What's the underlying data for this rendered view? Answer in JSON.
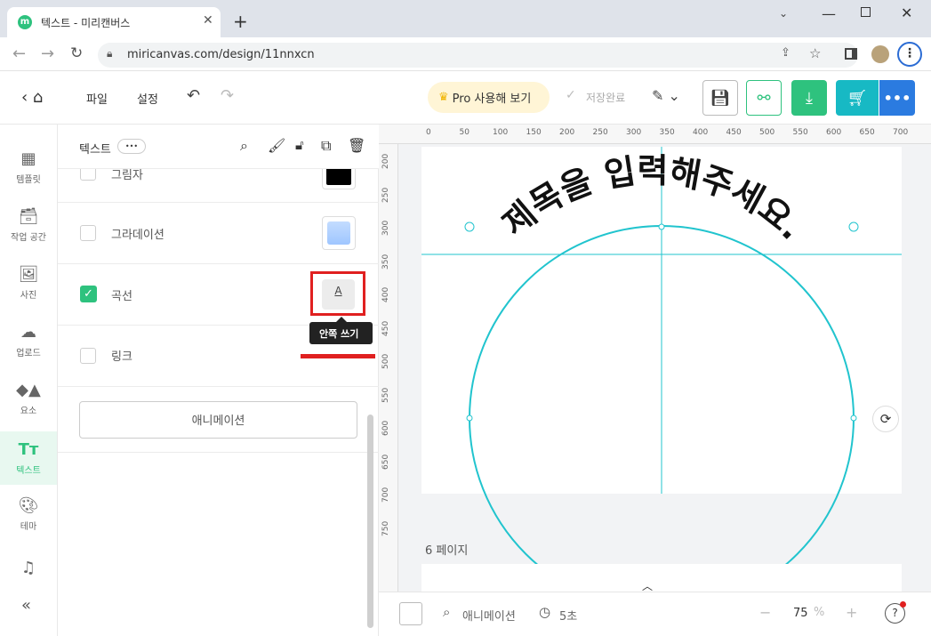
{
  "browser": {
    "tab_title": "텍스트 - 미리캔버스",
    "url": "miricanvas.com/design/11nnxcn"
  },
  "header": {
    "file": "파일",
    "settings": "설정",
    "pro": "Pro 사용해 보기",
    "saved": "저장완료"
  },
  "leftnav": {
    "items": [
      {
        "label": "템플릿",
        "icon": "template-icon"
      },
      {
        "label": "작업 공간",
        "icon": "archive-icon"
      },
      {
        "label": "사진",
        "icon": "image-icon"
      },
      {
        "label": "업로드",
        "icon": "upload-cloud-icon"
      },
      {
        "label": "요소",
        "icon": "shapes-icon"
      },
      {
        "label": "텍스트",
        "icon": "text-icon"
      },
      {
        "label": "테마",
        "icon": "palette-icon"
      }
    ]
  },
  "panel": {
    "title": "텍스트",
    "more": "•••",
    "rows": {
      "shadow": "그림자",
      "gradient": "그라데이션",
      "curve": "곡선",
      "link": "링크"
    },
    "animation_button": "애니메이션",
    "tooltip": "안쪽 쓰기"
  },
  "canvas": {
    "curved_text": "제목을 입력해주세요.",
    "ruler_top": [
      "0",
      "50",
      "100",
      "150",
      "200",
      "250",
      "300",
      "350",
      "400",
      "450",
      "500",
      "550",
      "600",
      "650",
      "700"
    ],
    "ruler_left": [
      "200",
      "250",
      "300",
      "350",
      "400",
      "450",
      "500",
      "550",
      "600",
      "650",
      "700",
      "750"
    ],
    "page_label": "6 페이지"
  },
  "bottombar": {
    "animation": "애니메이션",
    "duration": "5초",
    "zoom": "75",
    "zoom_unit": "%"
  },
  "colors": {
    "accent": "#21c4ce",
    "green": "#2ec27e",
    "red": "#e02020"
  }
}
